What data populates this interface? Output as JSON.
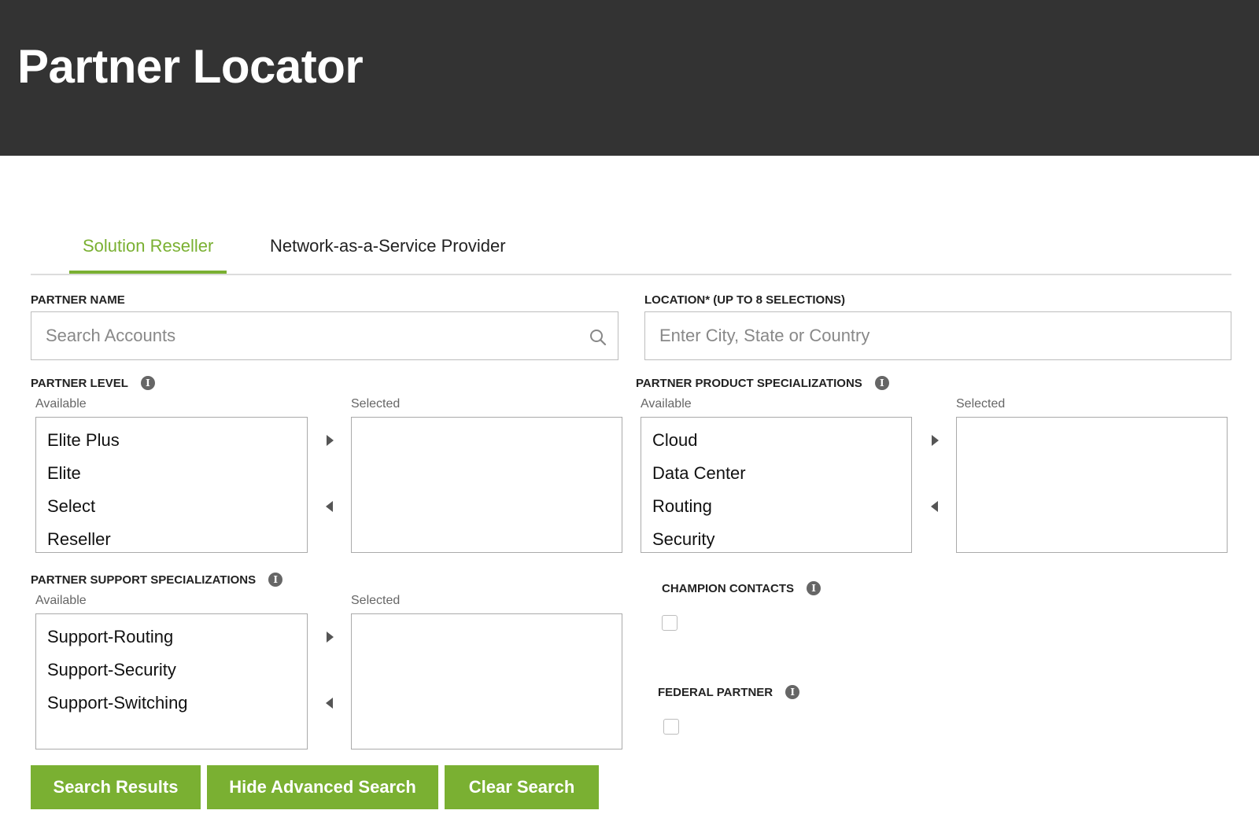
{
  "header": {
    "title": "Partner Locator",
    "bg_color": "#333333"
  },
  "accent_color": "#7ab032",
  "tabs": [
    {
      "label": "Solution Reseller",
      "active": true
    },
    {
      "label": "Network-as-a-Service Provider",
      "active": false
    }
  ],
  "partner_name": {
    "label": "PARTNER NAME",
    "placeholder": "Search Accounts",
    "value": "",
    "icon": "search-icon"
  },
  "location": {
    "label": "LOCATION* (UP TO 8 SELECTIONS)",
    "placeholder": "Enter City, State or Country",
    "value": ""
  },
  "partner_level": {
    "label": "PARTNER LEVEL",
    "available_label": "Available",
    "selected_label": "Selected",
    "available": [
      "Elite Plus",
      "Elite",
      "Select",
      "Reseller"
    ],
    "selected": []
  },
  "product_specializations": {
    "label": "PARTNER PRODUCT SPECIALIZATIONS",
    "available_label": "Available",
    "selected_label": "Selected",
    "available": [
      "Cloud",
      "Data Center",
      "Routing",
      "Security"
    ],
    "selected": []
  },
  "support_specializations": {
    "label": "PARTNER SUPPORT SPECIALIZATIONS",
    "available_label": "Available",
    "selected_label": "Selected",
    "available": [
      "Support-Routing",
      "Support-Security",
      "Support-Switching"
    ],
    "selected": []
  },
  "champion_contacts": {
    "label": "CHAMPION CONTACTS",
    "checked": false
  },
  "federal_partner": {
    "label": "FEDERAL PARTNER",
    "checked": false
  },
  "buttons": {
    "search": "Search Results",
    "hide_advanced": "Hide Advanced Search",
    "clear": "Clear Search"
  }
}
